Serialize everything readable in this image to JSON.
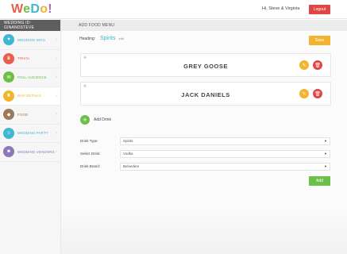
{
  "header": {
    "logo": {
      "w": "W",
      "e": "e",
      "d": "D",
      "o": "o",
      "ex": "!"
    },
    "greeting": "Hi, Steve & Virginia",
    "logout_label": "Logout"
  },
  "sidebar": {
    "wedding_id": "WEDDING ID: GINANDSTEVE",
    "items": [
      {
        "label": "WEDDING INFO",
        "color": "#3fb6d2",
        "icon": "info-icon"
      },
      {
        "label": "TRIVIA",
        "color": "#e8604c",
        "icon": "trivia-icon"
      },
      {
        "label": "POLL AUDIENCE",
        "color": "#6cc04a",
        "icon": "poll-icon"
      },
      {
        "label": "BAR DETAILS",
        "color": "#f2b42e",
        "icon": "bar-icon"
      },
      {
        "label": "FOOD",
        "color": "#9b7a5a",
        "icon": "food-icon"
      },
      {
        "label": "WEDDING PARTY",
        "color": "#3fb6d2",
        "icon": "party-icon"
      },
      {
        "label": "WEDDING VENDORS",
        "color": "#8a78b8",
        "icon": "vendors-icon"
      }
    ]
  },
  "main": {
    "page_title": "ADD FOOD MENU",
    "heading_label": "Heading:",
    "heading_value": "Spirits",
    "edit_label": "edit",
    "save_label": "Save",
    "drinks": [
      "GREY GOOSE",
      "JACK DANIELS"
    ],
    "add_drink_label": "Add Drink",
    "form": {
      "drink_type": {
        "label": "Drink Type:",
        "value": "Spirits"
      },
      "select_drink": {
        "label": "Select Drink:",
        "value": "Vodka"
      },
      "drink_brand": {
        "label": "Drink Brand:",
        "value": "Belvedere"
      }
    },
    "add_label": "Add"
  },
  "colors": {
    "accent_blue": "#3fb6d2",
    "accent_yellow": "#f2b42e",
    "accent_red": "#e04646",
    "accent_green": "#6cc04a"
  }
}
